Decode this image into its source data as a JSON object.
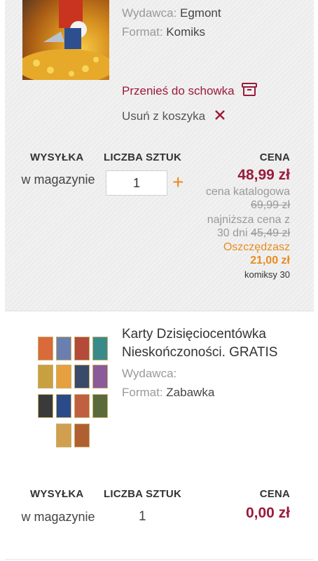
{
  "item1": {
    "publisher_label": "Wydawca:",
    "publisher": "Egmont",
    "format_label": "Format:",
    "format": "Komiks",
    "move_label": "Przenieś do schowka",
    "remove_label": "Usuń z koszyka",
    "headers": {
      "shipping": "WYSYŁKA",
      "quantity": "LICZBA SZTUK",
      "price": "CENA"
    },
    "shipping": "w magazynie",
    "quantity": "1",
    "plus": "+",
    "price": "48,99 zł",
    "catalog_label": "cena katalogowa",
    "catalog_price": "69,99 zł",
    "lowest_label_1": "najniższa cena z",
    "lowest_label_2": "30 dni",
    "lowest_price": "45,49 zł",
    "savings_label": "Oszczędzasz",
    "savings": "21,00 zł",
    "promo": "komiksy 30"
  },
  "item2": {
    "title_line1": "Karty Dzisięciocentówka",
    "title_line2": "Nieskończoności. GRATIS",
    "publisher_label": "Wydawca:",
    "publisher": "",
    "format_label": "Format:",
    "format": "Zabawka",
    "headers": {
      "shipping": "WYSYŁKA",
      "quantity": "LICZBA SZTUK",
      "price": "CENA"
    },
    "shipping": "w magazynie",
    "quantity": "1",
    "price": "0,00 zł"
  },
  "colors": {
    "accent": "#9b1b3a",
    "orange": "#e98b1f"
  },
  "icons": {
    "move": "archive-box-icon",
    "remove": "close-x-icon"
  }
}
